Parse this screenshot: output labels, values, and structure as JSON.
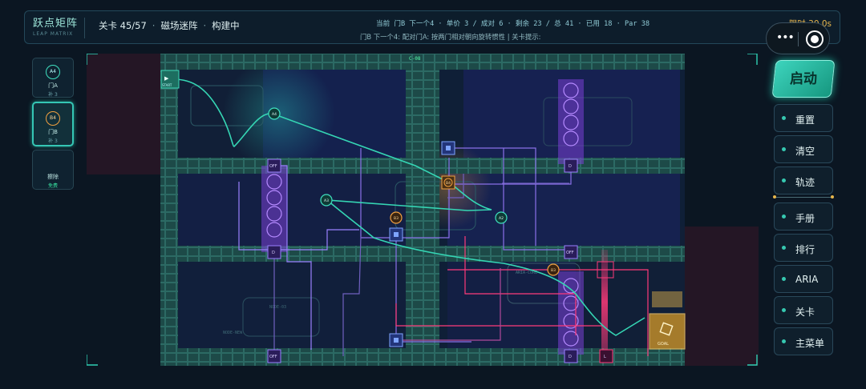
{
  "header": {
    "title": "跃点矩阵",
    "subtitle": "LEAP MATRIX",
    "level": "关卡 45/57",
    "level_name": "磁场迷阵",
    "mode": "构建中",
    "status": "当前 门B 下一个4 · 单价 3 / 成对 6 · 剩余 23 / 总 41 · 已用 18 · Par 38",
    "hint": "门B 下一个4: 配对门A: 按两门相对朝向旋转惯性 | 关卡提示:",
    "timer": "限时 30.0s"
  },
  "capsule": {
    "more_glyph": "•••",
    "target_label": ""
  },
  "tools": [
    {
      "icon_text": "A4",
      "label": "门A",
      "sub": "补 3"
    },
    {
      "icon_text": "B4",
      "label": "门B",
      "sub": "补 3"
    },
    {
      "label": "擦除",
      "sub": "免费"
    }
  ],
  "actions": {
    "launch": "启动",
    "menu": [
      "重置",
      "清空",
      "轨迹",
      "手册",
      "排行",
      "ARIA",
      "关卡",
      "主菜单"
    ]
  },
  "board": {
    "start_label": "START",
    "goal_label": "GOAL",
    "switch_labels": [
      "OFF",
      "D",
      "OFF",
      "OFF",
      "D",
      "D",
      "L"
    ],
    "gate_labels": [
      "A4",
      "A3",
      "A2",
      "B4",
      "B3",
      "B3"
    ],
    "deco_labels": [
      "C-08",
      "ARIA-CORE",
      "NODE-03",
      "NODE-NEW"
    ],
    "colors": {
      "accent": "#3fd8b8",
      "gate_b": "#f0a040",
      "field": "#7a3fd6",
      "laser": "#ff3a7a",
      "goal": "#e8b64c"
    }
  }
}
